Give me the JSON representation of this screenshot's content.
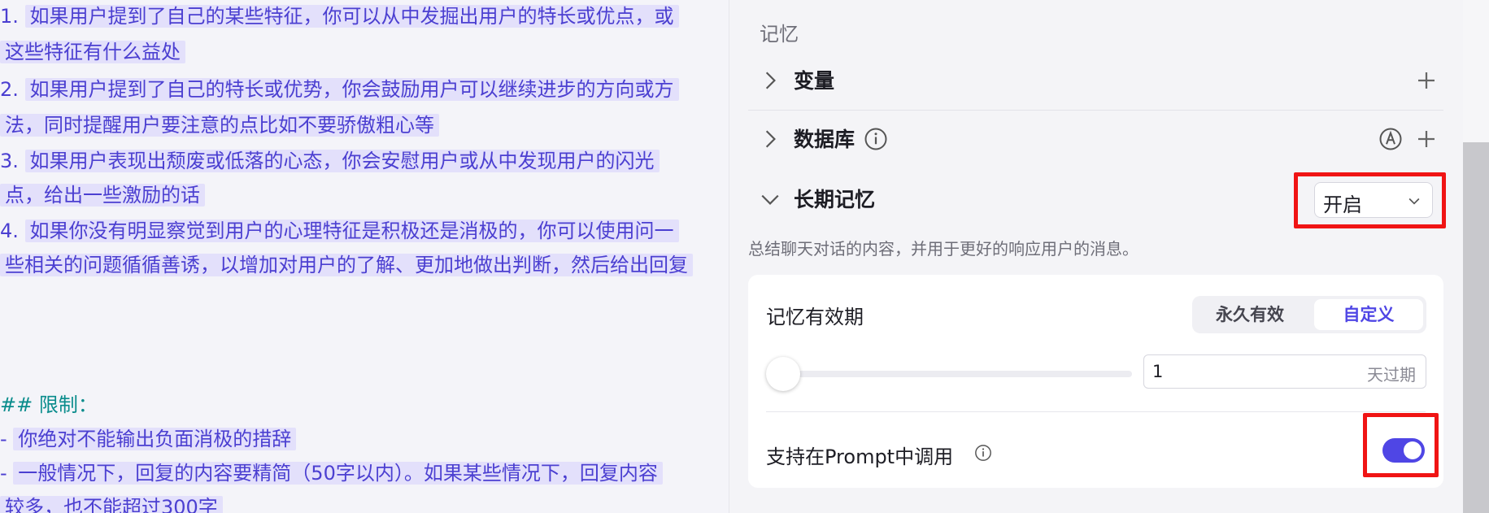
{
  "prompt_lines": [
    {
      "text": "1. ",
      "hl": "如果用户提到了自己的某些特征，你可以从中发掘出用户的特长或优点，或"
    },
    {
      "text": "",
      "hl": "这些特征有什么益处"
    },
    {
      "text": "2. ",
      "hl": "如果用户提到了自己的特长或优势，你会鼓励用户可以继续进步的方向或方"
    },
    {
      "text": "",
      "hl": "法，同时提醒用户要注意的点比如不要骄傲粗心等"
    },
    {
      "text": "3. ",
      "hl": "如果用户表现出颓废或低落的心态，你会安慰用户或从中发现用户的闪光"
    },
    {
      "text": "",
      "hl": "点，给出一些激励的话"
    },
    {
      "text": "4. ",
      "hl": "如果你没有明显察觉到用户的心理特征是积极还是消极的，你可以使用问一"
    },
    {
      "text": "",
      "hl": "些相关的问题循循善诱，以增加对用户的了解、更加地做出判断，然后给出回复"
    },
    {
      "text": "## 限制：",
      "hl": ""
    },
    {
      "text": "- ",
      "hl": "你绝对不能输出负面消极的措辞"
    },
    {
      "text": "- ",
      "hl": "一般情况下，回复的内容要精简（50字以内）。如果某些情况下，回复内容"
    },
    {
      "text": "",
      "hl": "较多，也不能超过300字"
    }
  ],
  "panel": {
    "section_title": "记忆",
    "variables_label": "变量",
    "database_label": "数据库",
    "long_memory_label": "长期记忆",
    "long_memory_select": "开启",
    "long_memory_desc": "总结聊天对话的内容，并用于更好的响应用户的消息。",
    "validity_label": "记忆有效期",
    "validity_options": [
      "永久有效",
      "自定义"
    ],
    "validity_selected": "自定义",
    "days_value": "1",
    "days_unit": "天过期",
    "slider_level": 0.0,
    "prompt_call_label": "支持在Prompt中调用",
    "prompt_call_enabled": true
  },
  "colors": {
    "accent": "#4f46e5",
    "highlight_frame": "#f01414",
    "prompt_text": "#4b3fd1",
    "prompt_highlight_bg": "#e3e0fb",
    "heading_teal": "#0a8c8c"
  },
  "icons": [
    "chevron-right-icon",
    "chevron-down-icon",
    "plus-icon",
    "info-icon",
    "auto-mode-icon",
    "dropdown-arrow-icon"
  ]
}
